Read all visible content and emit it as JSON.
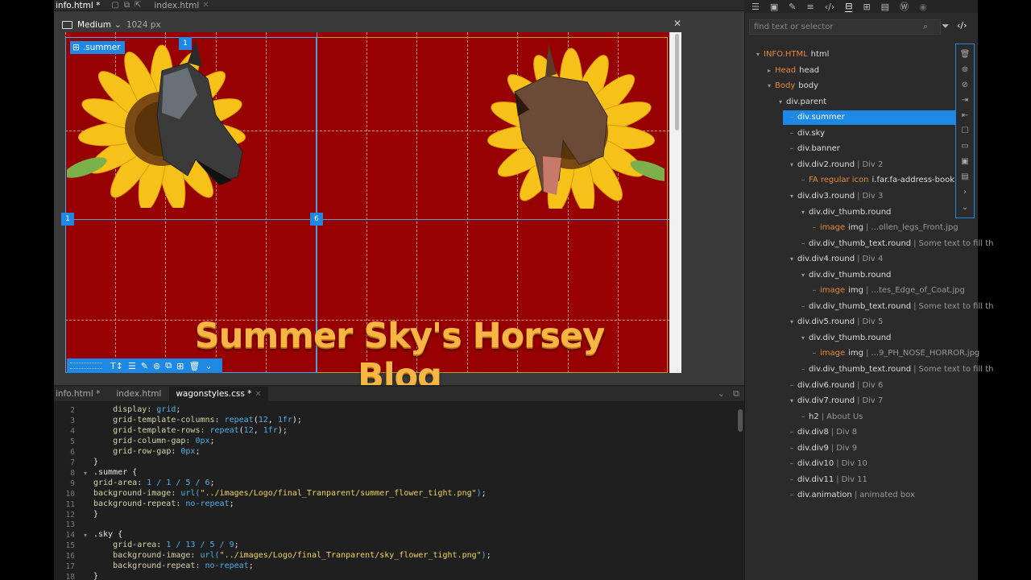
{
  "top_tabs": [
    {
      "label": "info.html *",
      "active": true
    },
    {
      "label": "index.html",
      "active": false
    }
  ],
  "preview": {
    "media_query": "Medium",
    "width_readout": "1024 px",
    "selected_label": ".summer",
    "grid_numbers": [
      "1",
      "1",
      "6"
    ],
    "blog_title": "Summer Sky's Horsey Blog"
  },
  "bottom_tabs": [
    {
      "label": "info.html *",
      "active": false
    },
    {
      "label": "index.html",
      "active": false
    },
    {
      "label": "wagonstyles.css *",
      "active": true
    }
  ],
  "code": {
    "line_numbers": [
      "2",
      "3",
      "4",
      "5",
      "6",
      "7",
      "8",
      "9",
      "10",
      "11",
      "12",
      "13",
      "14",
      "15",
      "16",
      "17",
      "18"
    ],
    "lines": [
      "    display: grid;",
      "    grid-template-columns: repeat(12, 1fr);",
      "    grid-template-rows: repeat(12, 1fr);",
      "    grid-column-gap: 0px;",
      "    grid-row-gap: 0px;",
      "}",
      ".summer {",
      "grid-area: 1 / 1 / 5 / 6;",
      "background-image: url(\"../images/Logo/final_Tranparent/summer_flower_tight.png\");",
      "background-repeat: no-repeat;",
      "}",
      "",
      ".sky {",
      "    grid-area: 1 / 13 / 5 / 9;",
      "    background-image: url(\"../images/Logo/final_Tranparent/sky_flower_tight.png\");",
      "    background-repeat: no-repeat;",
      "}"
    ]
  },
  "dom_panel": {
    "search_placeholder": "find text or selector",
    "nodes": [
      {
        "pre": "INFO.HTML",
        "name": "html",
        "rest": ""
      },
      {
        "pre": "Head",
        "name": "head",
        "rest": ""
      },
      {
        "pre": "Body",
        "name": "body",
        "rest": ""
      },
      {
        "pre": "",
        "name": "div.parent",
        "rest": ""
      },
      {
        "pre": "",
        "name": "div.summer",
        "rest": ""
      },
      {
        "pre": "",
        "name": "div.sky",
        "rest": ""
      },
      {
        "pre": "",
        "name": "div.banner",
        "rest": ""
      },
      {
        "pre": "",
        "name": "div.div2.round",
        "rest": "Div 2"
      },
      {
        "pre": "FA regular icon",
        "name": "i.far.fa-address-book",
        "rest": ""
      },
      {
        "pre": "",
        "name": "div.div3.round",
        "rest": "Div 3"
      },
      {
        "pre": "",
        "name": "div.div_thumb.round",
        "rest": ""
      },
      {
        "pre": "image",
        "name": "img",
        "rest": "...ollen_legs_Front.jpg"
      },
      {
        "pre": "",
        "name": "div.div_thumb_text.round",
        "rest": "Some text to fill th"
      },
      {
        "pre": "",
        "name": "div.div4.round",
        "rest": "Div 4"
      },
      {
        "pre": "",
        "name": "div.div_thumb.round",
        "rest": ""
      },
      {
        "pre": "image",
        "name": "img",
        "rest": "...tes_Edge_of_Coat.jpg"
      },
      {
        "pre": "",
        "name": "div.div_thumb_text.round",
        "rest": "Some text to fill th"
      },
      {
        "pre": "",
        "name": "div.div5.round",
        "rest": "Div 5"
      },
      {
        "pre": "",
        "name": "div.div_thumb.round",
        "rest": ""
      },
      {
        "pre": "image",
        "name": "img",
        "rest": "...9_PH_NOSE_HORROR.jpg"
      },
      {
        "pre": "",
        "name": "div.div_thumb_text.round",
        "rest": "Some text to fill th"
      },
      {
        "pre": "",
        "name": "div.div6.round",
        "rest": "Div 6"
      },
      {
        "pre": "",
        "name": "div.div7.round",
        "rest": "Div 7"
      },
      {
        "pre": "",
        "name": "h2",
        "rest": "About Us"
      },
      {
        "pre": "",
        "name": "div.div8",
        "rest": "Div 8"
      },
      {
        "pre": "",
        "name": "div.div9",
        "rest": "Div 9"
      },
      {
        "pre": "",
        "name": "div.div10",
        "rest": "Div 10"
      },
      {
        "pre": "",
        "name": "div.div11",
        "rest": "Div 11"
      },
      {
        "pre": "",
        "name": "div.animation",
        "rest": "animated box"
      }
    ]
  },
  "colors": {
    "canvas_bg": "#960000",
    "accent": "#1e88e5",
    "title": "#f7b643"
  }
}
